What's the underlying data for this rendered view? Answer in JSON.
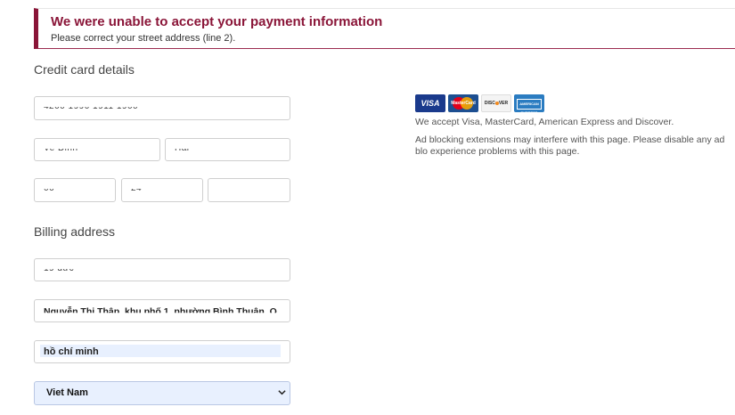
{
  "alert": {
    "title": "We were unable to accept your payment information",
    "message": "Please correct your street address (line 2)."
  },
  "credit_card": {
    "section_title": "Credit card details",
    "card_number": "4200 1990 1911 1900",
    "name_first": "Ve Đinh",
    "name_last": "Hải",
    "exp_month": "06",
    "exp_year": "24",
    "cvv": ""
  },
  "billing": {
    "section_title": "Billing address",
    "address_line1": "19 đức",
    "address_line2": "Nguyễn Thị Thập, khu phố 1, phường Bình Thuận, Q",
    "city": "hồ chí minh",
    "country": "Viet Nam"
  },
  "payment_info": {
    "card_logos": [
      "VISA",
      "MasterCard",
      "DISCOVER",
      "AMERICAN EXPRESS"
    ],
    "accept_text": "We accept Visa, MasterCard, American Express and Discover.",
    "adblock_text": "Ad blocking extensions may interfere with this page. Please disable any ad blo experience problems with this page."
  },
  "colors": {
    "alert_accent": "#8a1538",
    "autofill_bg": "#e8f0fe"
  }
}
